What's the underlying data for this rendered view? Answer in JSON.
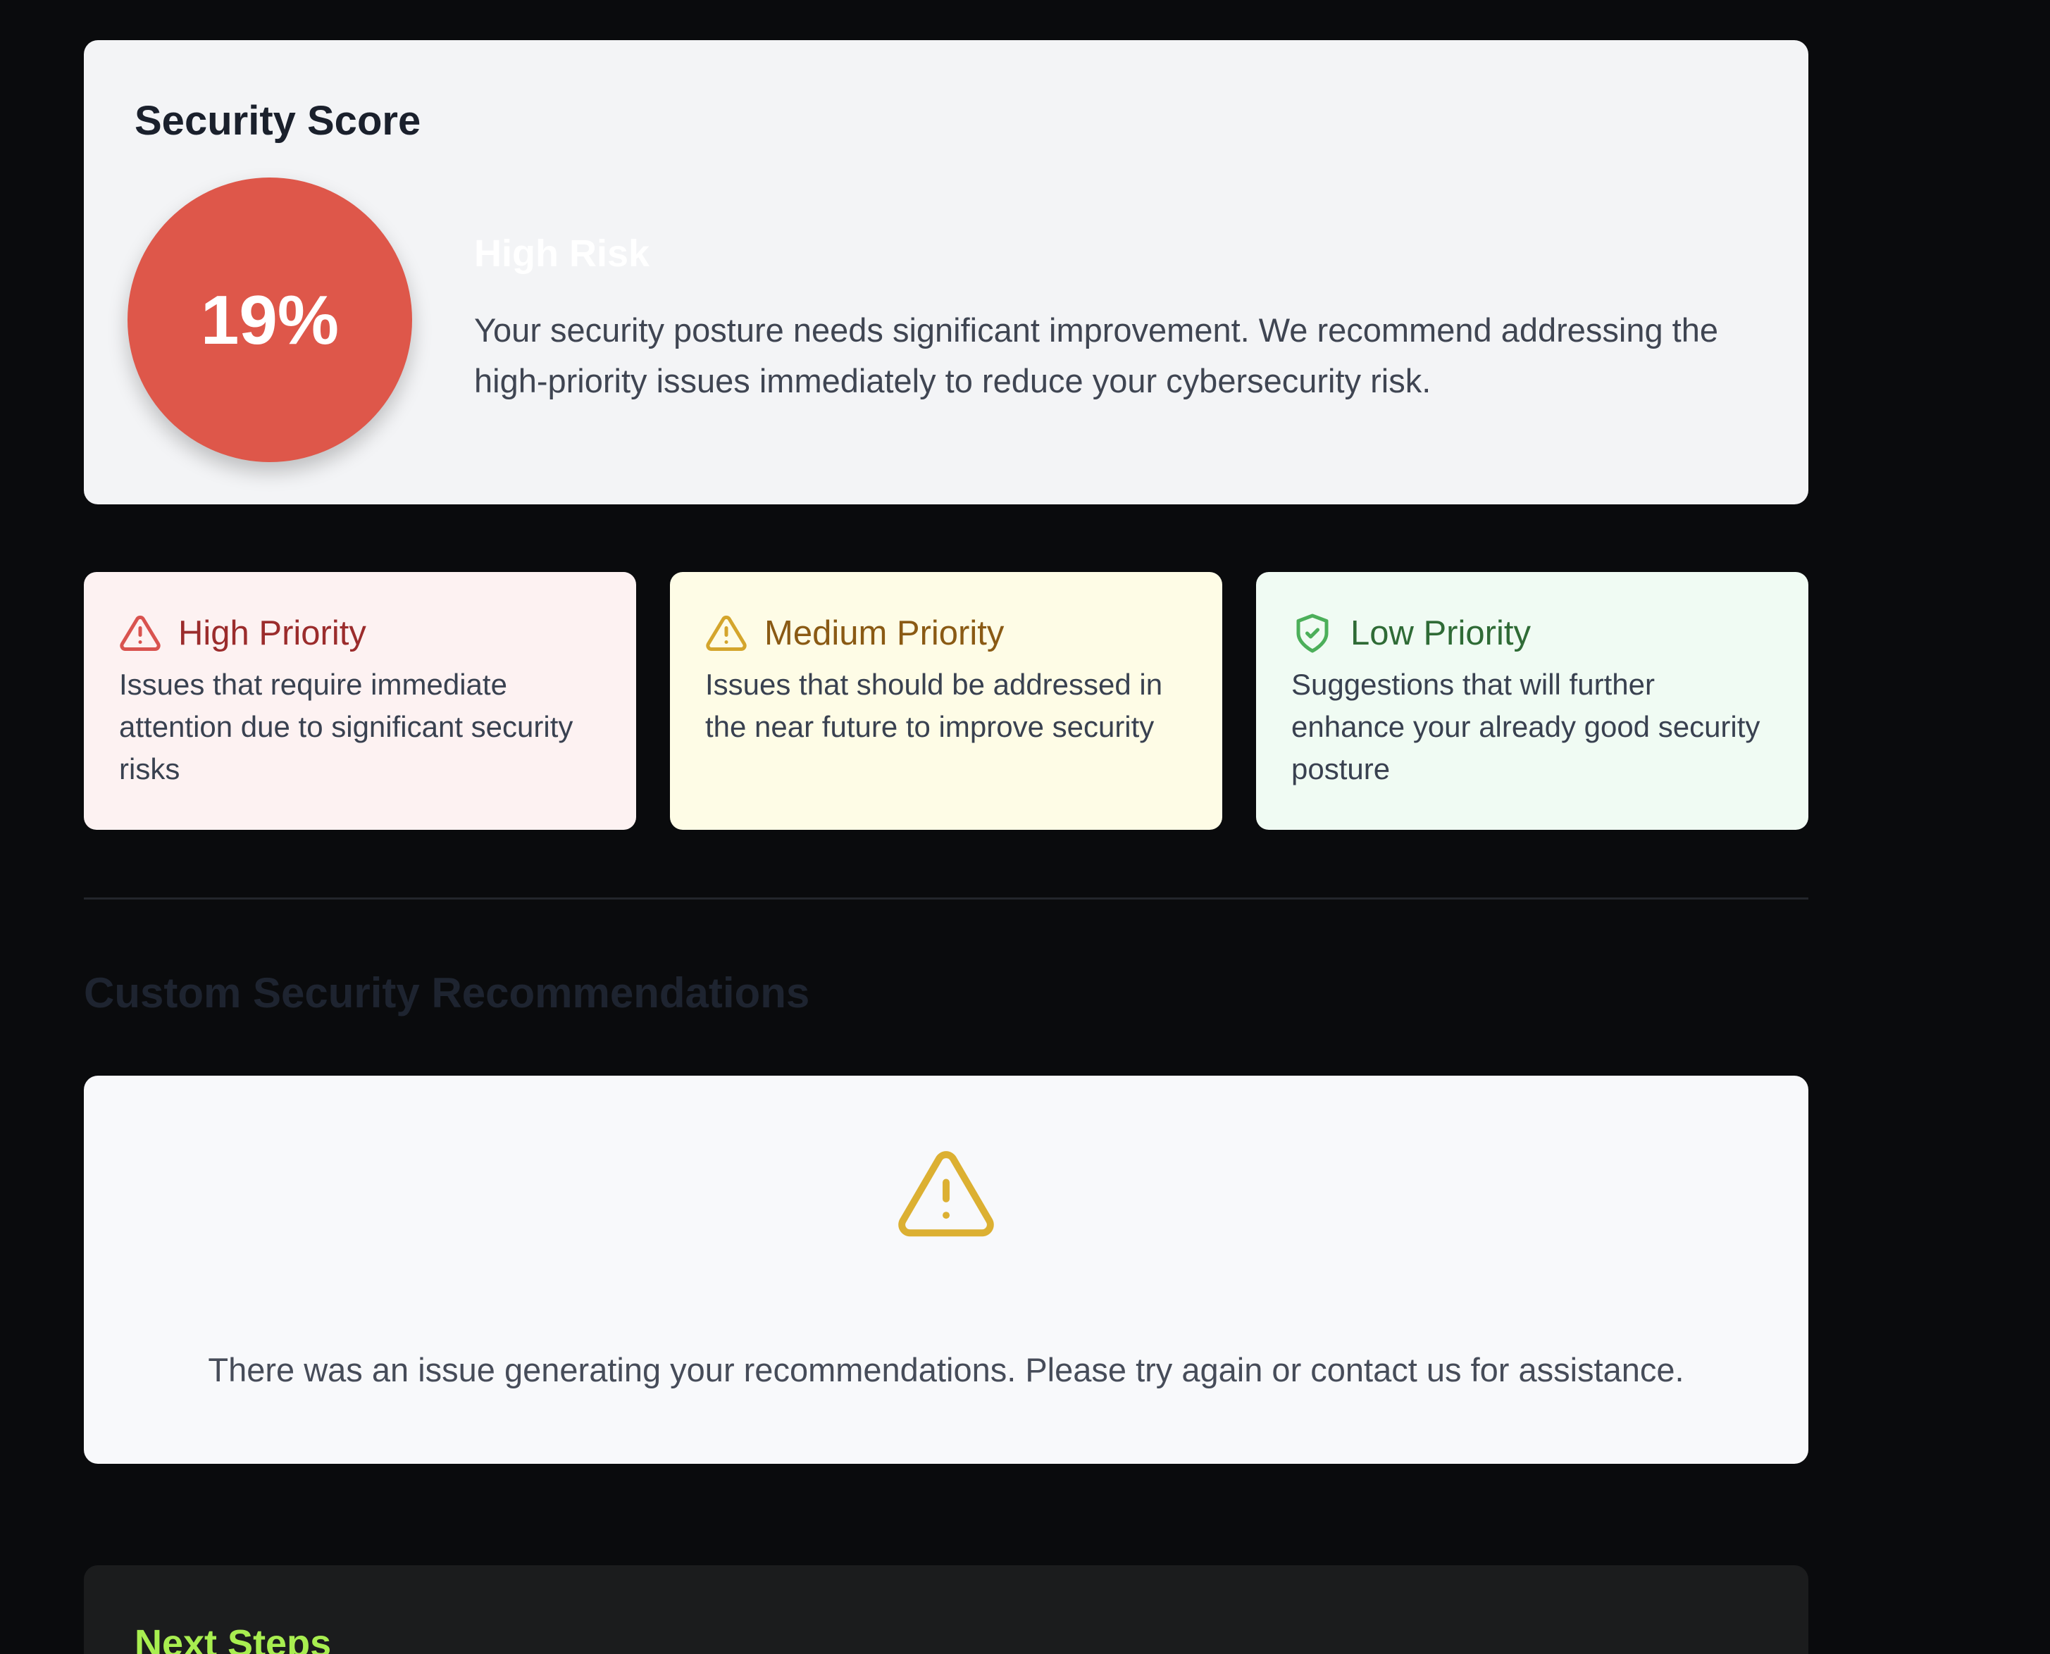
{
  "score": {
    "title": "Security Score",
    "value": "19%",
    "risk_level": "High Risk",
    "description": "Your security posture needs significant improvement. We recommend addressing the high-priority issues immediately to reduce your cybersecurity risk.",
    "circle_color": "#de574a"
  },
  "priorities": [
    {
      "icon": "warning-triangle-icon",
      "title": "High Priority",
      "description": "Issues that require immediate attention due to significant security risks",
      "color": "#d9534f"
    },
    {
      "icon": "warning-triangle-icon",
      "title": "Medium Priority",
      "description": "Issues that should be addressed in the near future to improve security",
      "color": "#d4a52c"
    },
    {
      "icon": "shield-check-icon",
      "title": "Low Priority",
      "description": "Suggestions that will further enhance your already good security posture",
      "color": "#4caf5a"
    }
  ],
  "recommendations": {
    "title": "Custom Security Recommendations",
    "icon": "warning-triangle-icon",
    "icon_color": "#dcb032",
    "message": "There was an issue generating your recommendations. Please try again or contact us for assistance."
  },
  "next_steps": {
    "title": "Next Steps"
  }
}
